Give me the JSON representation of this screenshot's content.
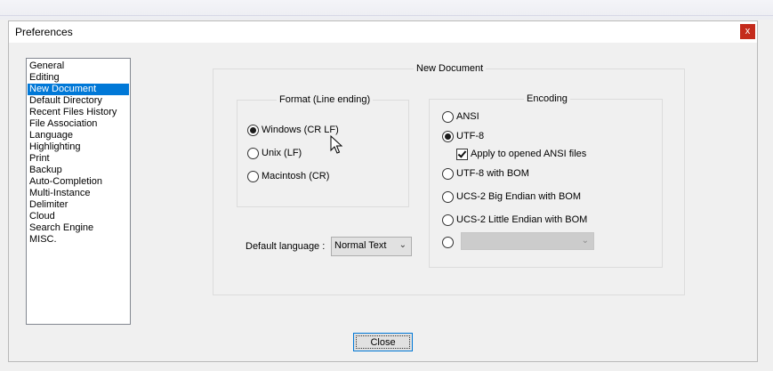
{
  "window": {
    "title": "Preferences",
    "close_glyph": "x"
  },
  "sidebar": {
    "items": [
      {
        "label": "General"
      },
      {
        "label": "Editing"
      },
      {
        "label": "New Document",
        "selected": true
      },
      {
        "label": "Default Directory"
      },
      {
        "label": "Recent Files History"
      },
      {
        "label": "File Association"
      },
      {
        "label": "Language"
      },
      {
        "label": "Highlighting"
      },
      {
        "label": "Print"
      },
      {
        "label": "Backup"
      },
      {
        "label": "Auto-Completion"
      },
      {
        "label": "Multi-Instance"
      },
      {
        "label": "Delimiter"
      },
      {
        "label": "Cloud"
      },
      {
        "label": "Search Engine"
      },
      {
        "label": "MISC."
      }
    ]
  },
  "new_document": {
    "group_title": "New Document",
    "format": {
      "title": "Format (Line ending)",
      "options": [
        "Windows (CR LF)",
        "Unix (LF)",
        "Macintosh (CR)"
      ],
      "selected": "Windows (CR LF)"
    },
    "encoding": {
      "title": "Encoding",
      "options": [
        "ANSI",
        "UTF-8",
        "UTF-8 with BOM",
        "UCS-2 Big Endian with BOM",
        "UCS-2 Little Endian with BOM"
      ],
      "selected": "UTF-8",
      "apply_ansi_label": "Apply to opened ANSI files",
      "apply_ansi_checked": true,
      "other_combo_value": ""
    },
    "default_language": {
      "label": "Default language :",
      "value": "Normal Text"
    }
  },
  "footer": {
    "close_label": "Close"
  },
  "colors": {
    "selection": "#0078d7",
    "close_button": "#c42b1c"
  }
}
